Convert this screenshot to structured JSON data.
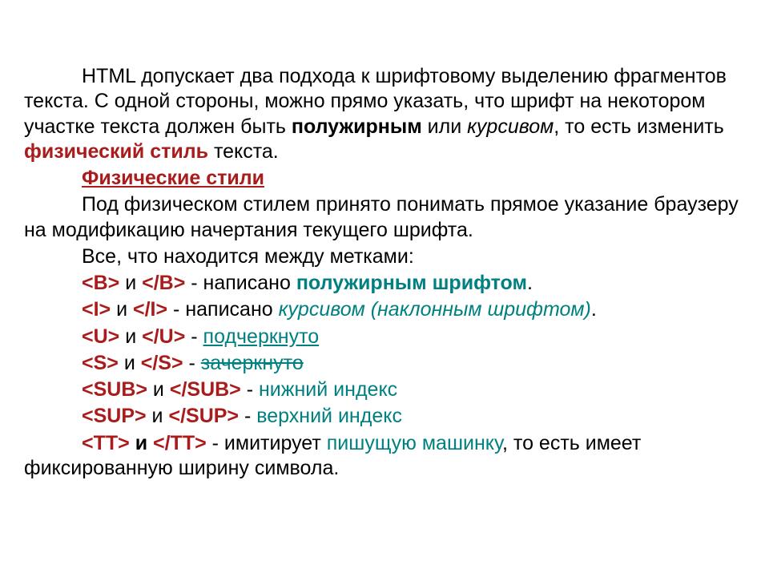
{
  "p1": {
    "t1": "HTML допускает два подхода к шрифтовому выделению фрагментов текста. С одной стороны, можно прямо указать, что шрифт на некотором участке текста должен быть ",
    "bold": "полужирным",
    "t2": " или ",
    "italic": "курсивом",
    "t3": ", то есть изменить ",
    "phys": "физический стиль",
    "t4": " текста."
  },
  "heading": "Физические стили",
  "p2": "Под физическом стилем принято понимать прямое указание браузеру на модификацию начертания текущего шрифта.",
  "p3": "Все, что находится между метками:",
  "lineB": {
    "open": "<B>",
    "and": " и ",
    "close": "</B>",
    "mid": " - написано ",
    "styled": "полужирным шрифтом",
    "end": "."
  },
  "lineI": {
    "open": "<I>",
    "and": " и ",
    "close": "</I>",
    "mid": " - написано ",
    "styled": "курсивом (наклонным шрифтом)",
    "end": "."
  },
  "lineU": {
    "open": "<U>",
    "and": " и ",
    "close": "</U>",
    "mid": " - ",
    "styled": "подчеркнуто"
  },
  "lineS": {
    "open": "<S>",
    "and": " и ",
    "close": "</S>",
    "mid": " - ",
    "styled": "зачеркнуто"
  },
  "lineSub": {
    "open": "<SUB>",
    "and": " и ",
    "close": "</SUB>",
    "mid": " - ",
    "styled": "нижний индекс"
  },
  "lineSup": {
    "open": "<SUP>",
    "and": " и ",
    "close": "</SUP>",
    "mid": " - ",
    "styled": "верхний индекс"
  },
  "lineTT": {
    "open": "<TT>",
    "and": " и ",
    "close": "</TT>",
    "mid": " - имитирует ",
    "styled": "пишущую машинку",
    "end": ", то есть имеет фиксированную ширину символа."
  }
}
